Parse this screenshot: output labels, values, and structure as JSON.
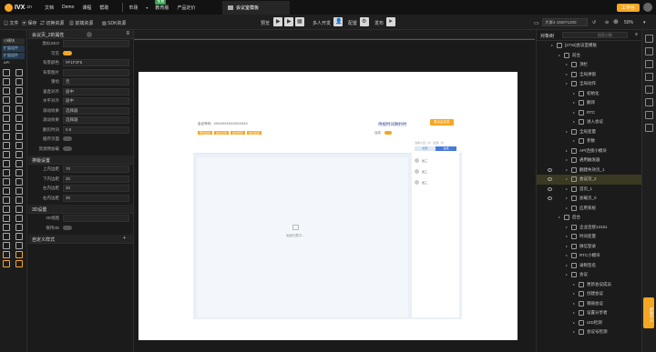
{
  "topbar": {
    "logo": "IVX",
    "logo_sub": ".cn",
    "menu": [
      "文档",
      "Demo",
      "课程",
      "帮助"
    ],
    "market": "市场",
    "nav2": [
      "教育版",
      "产品定价"
    ],
    "free_badge": "免费",
    "doc_tab": "会议室模板",
    "workbench": "工作台"
  },
  "toolbar": {
    "file": "文件",
    "save": "保存",
    "cut_resource": "切换资源",
    "frontend_resource": "前端资源",
    "sdk_resource": "SDK资源",
    "preview": "预览",
    "multi_dev": "多人开发",
    "config": "配置",
    "publish": "发布",
    "size_select": "大屏4 1920*1200",
    "zoom": "50%"
  },
  "left_tools": {
    "tabs": [
      "小模块",
      "扩展组件",
      "扩展组件",
      "API"
    ]
  },
  "props": {
    "header": "会议页_2的属性",
    "rows": [
      {
        "label": "类似SEO",
        "value": ""
      },
      {
        "label": "可见",
        "value": "toggle-on"
      },
      {
        "label": "背景颜色",
        "value": "#F1F2F5"
      },
      {
        "label": "背景图片",
        "value": ""
      },
      {
        "label": "重绘",
        "value": "否"
      },
      {
        "label": "垂直对齐",
        "value": "居中"
      },
      {
        "label": "水平对齐",
        "value": "居中"
      },
      {
        "label": "滚动效果",
        "value": "选择器"
      },
      {
        "label": "滚动效果",
        "value": "选择器"
      },
      {
        "label": "翻页时间",
        "value": "0.8"
      },
      {
        "label": "缓存页面",
        "value": "toggle-off"
      },
      {
        "label": "资源预加载",
        "value": "toggle-off"
      }
    ],
    "layout_header": "排版设置",
    "layout_rows": [
      {
        "label": "上内边距",
        "value": "70"
      },
      {
        "label": "下内边距",
        "value": "30"
      },
      {
        "label": "左内边距",
        "value": "30"
      },
      {
        "label": "右内边距",
        "value": "30"
      }
    ],
    "threed_header": "3D设置",
    "threed_rows": [
      {
        "label": "3D视图",
        "value": ""
      },
      {
        "label": "保持3D",
        "value": "toggle-off"
      }
    ],
    "custom_header": "自定义样式"
  },
  "canvas": {
    "meeting_code": "会议号码：XXXXXXXXXXXXXXXX",
    "title": "待视时间剩约时",
    "button": "退出会议室",
    "status": "连线",
    "tags": [
      "申请发言",
      "会议记录",
      "会议时长",
      "会议结束"
    ],
    "tabs": [
      "成员",
      "在线"
    ],
    "count_label": "当前人员（3）/全部（3）",
    "members": [
      "张三",
      "张三",
      "张三"
    ],
    "center_placeholder": "画面加载中..."
  },
  "right_panel": {
    "title": "对象树",
    "search_placeholder": "搜索对象",
    "tree": [
      {
        "indent": 0,
        "label": "[2732]会议室模板",
        "sel": false,
        "eye": false
      },
      {
        "indent": 1,
        "label": "前台",
        "sel": false,
        "eye": false
      },
      {
        "indent": 2,
        "label": "顶栏",
        "sel": false,
        "eye": false
      },
      {
        "indent": 2,
        "label": "全局弹窗",
        "sel": false,
        "eye": false
      },
      {
        "indent": 2,
        "label": "全局动作",
        "sel": false,
        "eye": false
      },
      {
        "indent": 3,
        "label": "初始化",
        "sel": false,
        "eye": false
      },
      {
        "indent": 3,
        "label": "翻译",
        "sel": false,
        "eye": false
      },
      {
        "indent": 3,
        "label": "RTC",
        "sel": false,
        "eye": false
      },
      {
        "indent": 3,
        "label": "进入会议",
        "sel": false,
        "eye": false
      },
      {
        "indent": 2,
        "label": "全局变量",
        "sel": false,
        "eye": false
      },
      {
        "indent": 3,
        "label": "参数",
        "sel": false,
        "eye": false
      },
      {
        "indent": 2,
        "label": "API连接小模块",
        "sel": false,
        "eye": false
      },
      {
        "indent": 2,
        "label": "通用触发器",
        "sel": false,
        "eye": false
      },
      {
        "indent": 2,
        "label": "翻建失效页_1",
        "sel": false,
        "eye": true
      },
      {
        "indent": 2,
        "label": "会议页_2",
        "sel": true,
        "eye": true
      },
      {
        "indent": 2,
        "label": "首页_1",
        "sel": false,
        "eye": true
      },
      {
        "indent": 2,
        "label": "加载页_0",
        "sel": false,
        "eye": true
      },
      {
        "indent": 2,
        "label": "应用系统",
        "sel": false,
        "eye": false
      },
      {
        "indent": 1,
        "label": "后台",
        "sel": false,
        "eye": false
      },
      {
        "indent": 2,
        "label": "企业连接13151",
        "sel": false,
        "eye": false
      },
      {
        "indent": 2,
        "label": "时间变量",
        "sel": false,
        "eye": false
      },
      {
        "indent": 2,
        "label": "微信登录",
        "sel": false,
        "eye": false
      },
      {
        "indent": 2,
        "label": "RTC小模块",
        "sel": false,
        "eye": false
      },
      {
        "indent": 2,
        "label": "录制签名",
        "sel": false,
        "eye": false
      },
      {
        "indent": 2,
        "label": "会议",
        "sel": false,
        "eye": false
      },
      {
        "indent": 3,
        "label": "更新会议成员",
        "sel": false,
        "eye": false
      },
      {
        "indent": 3,
        "label": "创建会议",
        "sel": false,
        "eye": false
      },
      {
        "indent": 3,
        "label": "销毁会议",
        "sel": false,
        "eye": false
      },
      {
        "indent": 3,
        "label": "设置分享者",
        "sel": false,
        "eye": false
      },
      {
        "indent": 3,
        "label": "UID检测",
        "sel": false,
        "eye": false
      },
      {
        "indent": 3,
        "label": "会议号检测",
        "sel": false,
        "eye": false
      }
    ]
  },
  "help": "帮助中心",
  "colors": {
    "accent": "#f5a623",
    "teal": "#2aa3a8",
    "blue": "#4a7ad9"
  }
}
